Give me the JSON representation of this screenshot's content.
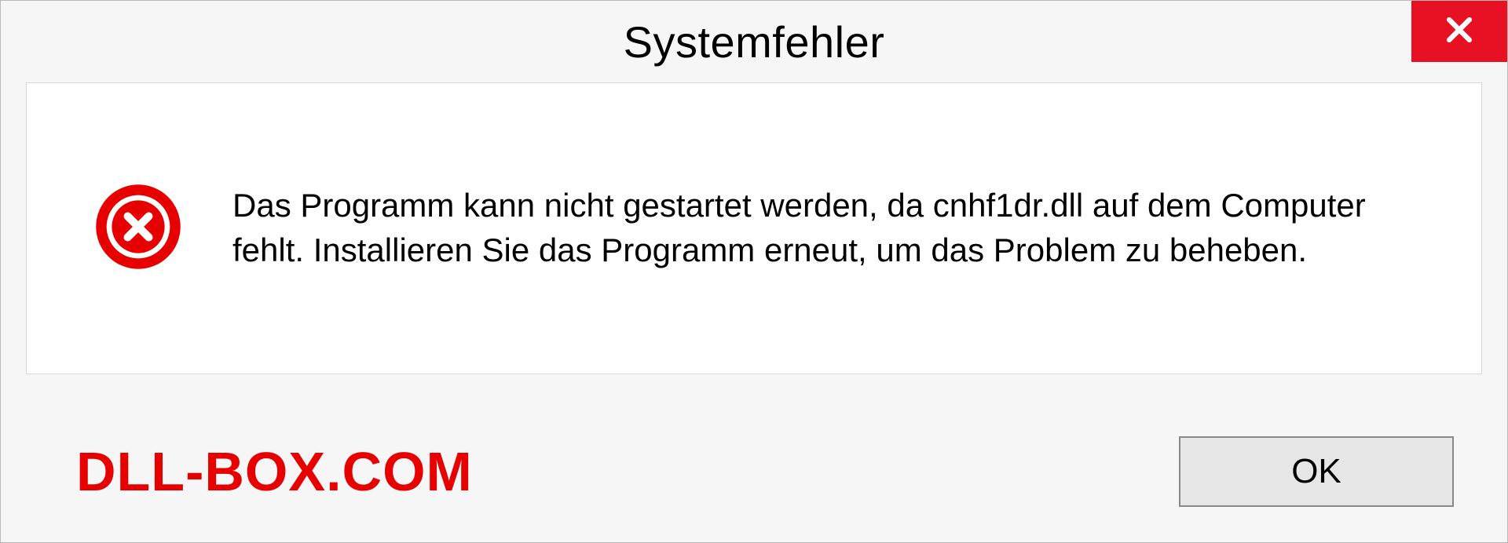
{
  "dialog": {
    "title": "Systemfehler",
    "message": "Das Programm kann nicht gestartet werden, da cnhf1dr.dll auf dem Computer fehlt. Installieren Sie das Programm erneut, um das Problem zu beheben.",
    "ok_label": "OK"
  },
  "watermark": "DLL-BOX.COM",
  "colors": {
    "close_bg": "#e81123",
    "error_icon": "#e60000",
    "watermark": "#e60000"
  }
}
